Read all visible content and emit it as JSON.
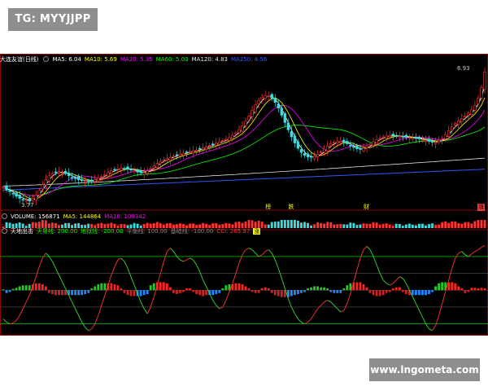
{
  "watermarks": {
    "top": "TG: MYYJJPP",
    "bottom": "www.lngometa.com"
  },
  "colors": {
    "bg": "#000000",
    "grid": "#8b0000",
    "up": "#ff3333",
    "down": "#33e0e0",
    "ma5": "#ffffff",
    "ma10": "#ffff00",
    "ma20": "#ff00ff",
    "ma60": "#00ff00",
    "ma120": "#e6e6e6",
    "ma250": "#3355ff",
    "vol": "#ffffff"
  },
  "price_legend": {
    "title": "大连友谊(日线)",
    "ma5": "MA5: 6.04",
    "ma10": "MA10: 5.69",
    "ma20": "MA20: 5.35",
    "ma60": "MA60: 5.03",
    "ma120": "MA120: 4.83",
    "ma250": "MA250: 4.56"
  },
  "price_labels": {
    "high": "6.93",
    "low": "3.77"
  },
  "tags": [
    {
      "text": "榜",
      "index": 81
    },
    {
      "text": "跌",
      "index": 88
    },
    {
      "text": "财",
      "index": 111
    },
    {
      "text": "涨",
      "index": 146
    }
  ],
  "volume_legend": {
    "title": "VOLUME: 156871",
    "ma5": "MA5: 144864",
    "ma10": "MA10: 109342"
  },
  "indicator_legend": {
    "title": "天地出击",
    "sky": "天界线: 200.00",
    "ground": "地狱线: -200.00",
    "mid": "平衡线: 100.00",
    "base": "基础线: -100.00",
    "cci": "CCI: 265.97",
    "tag": "涨"
  },
  "chart_data": {
    "type": "candlestick",
    "title": "大连友谊(日线)",
    "price_range": [
      3.6,
      7.1
    ],
    "indicator_range": [
      -260,
      330
    ],
    "last_values": {
      "ma5": 6.04,
      "ma10": 5.69,
      "ma20": 5.35,
      "ma60": 5.03,
      "ma120": 4.83,
      "ma250": 4.56,
      "volume": 156871,
      "vol_ma5": 144864,
      "vol_ma10": 109342,
      "cci": 265.97
    },
    "levels": {
      "sky": 200,
      "ground": -200,
      "mid": 100,
      "base": -100
    },
    "close_series": [
      4.12,
      4.05,
      4.01,
      3.96,
      3.9,
      3.85,
      3.82,
      3.8,
      3.78,
      3.84,
      3.93,
      4.04,
      4.18,
      4.31,
      4.4,
      4.46,
      4.49,
      4.5,
      4.48,
      4.45,
      4.4,
      4.36,
      4.33,
      4.3,
      4.28,
      4.27,
      4.26,
      4.28,
      4.31,
      4.34,
      4.38,
      4.43,
      4.48,
      4.52,
      4.55,
      4.57,
      4.58,
      4.58,
      4.57,
      4.55,
      4.52,
      4.49,
      4.47,
      4.48,
      4.52,
      4.58,
      4.64,
      4.7,
      4.75,
      4.79,
      4.82,
      4.85,
      4.88,
      4.91,
      4.93,
      4.95,
      4.97,
      4.99,
      5.01,
      5.03,
      5.05,
      5.08,
      5.11,
      5.14,
      5.17,
      5.2,
      5.23,
      5.26,
      5.29,
      5.33,
      5.38,
      5.45,
      5.53,
      5.62,
      5.73,
      5.86,
      6.0,
      6.13,
      6.24,
      6.32,
      6.36,
      6.35,
      6.29,
      6.19,
      6.05,
      5.88,
      5.7,
      5.52,
      5.35,
      5.2,
      5.07,
      4.97,
      4.9,
      4.86,
      4.85,
      4.87,
      4.92,
      4.98,
      5.05,
      5.12,
      5.18,
      5.22,
      5.24,
      5.24,
      5.22,
      5.18,
      5.13,
      5.09,
      5.06,
      5.05,
      5.07,
      5.11,
      5.17,
      5.23,
      5.28,
      5.32,
      5.35,
      5.37,
      5.38,
      5.38,
      5.37,
      5.36,
      5.35,
      5.34,
      5.33,
      5.32,
      5.31,
      5.3,
      5.28,
      5.26,
      5.24,
      5.22,
      5.22,
      5.25,
      5.31,
      5.4,
      5.5,
      5.6,
      5.68,
      5.74,
      5.8,
      5.86,
      5.93,
      6.01,
      6.12,
      6.3,
      6.55,
      6.93
    ],
    "cci_series": [
      -170,
      -190,
      -200,
      -195,
      -180,
      -150,
      -110,
      -70,
      -30,
      20,
      80,
      140,
      190,
      220,
      200,
      170,
      130,
      90,
      50,
      10,
      -30,
      -70,
      -110,
      -150,
      -190,
      -220,
      -240,
      -230,
      -200,
      -150,
      -90,
      -30,
      30,
      90,
      140,
      180,
      190,
      170,
      130,
      80,
      30,
      -20,
      -70,
      -110,
      -140,
      -100,
      -40,
      30,
      100,
      170,
      230,
      250,
      230,
      200,
      180,
      170,
      180,
      190,
      180,
      150,
      110,
      60,
      20,
      -20,
      -60,
      -90,
      -110,
      -100,
      -60,
      -10,
      40,
      100,
      160,
      210,
      240,
      250,
      240,
      220,
      200,
      210,
      230,
      240,
      220,
      180,
      130,
      70,
      10,
      -50,
      -100,
      -140,
      -170,
      -190,
      -200,
      -190,
      -170,
      -140,
      -110,
      -90,
      -70,
      -60,
      -70,
      -90,
      -110,
      -130,
      -120,
      -80,
      -20,
      50,
      120,
      190,
      240,
      260,
      240,
      200,
      150,
      100,
      60,
      40,
      30,
      40,
      60,
      80,
      70,
      40,
      0,
      -40,
      -80,
      -120,
      -160,
      -200,
      -230,
      -240,
      -210,
      -150,
      -80,
      -10,
      60,
      130,
      190,
      220,
      230,
      210,
      200,
      215,
      230,
      240,
      255,
      266
    ]
  }
}
